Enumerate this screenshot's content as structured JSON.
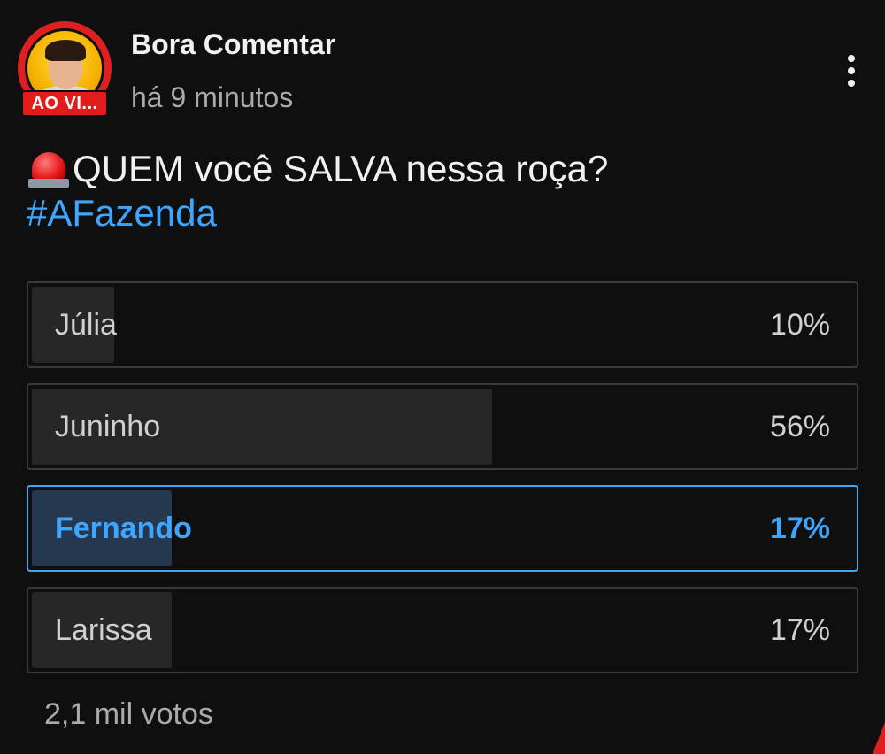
{
  "post": {
    "channel_name": "Bora Comentar",
    "timestamp": "há 9 minutos",
    "live_badge": "AO VI...",
    "avatar_icon": "channel-avatar",
    "menu_icon": "more-vert-icon",
    "question_text": "QUEM você SALVA nessa roça?",
    "question_icon": "police-siren-emoji",
    "hashtag": "#AFazenda"
  },
  "poll": {
    "options": [
      {
        "label": "Júlia",
        "percent_text": "10%",
        "percent": 10,
        "selected": false
      },
      {
        "label": "Juninho",
        "percent_text": "56%",
        "percent": 56,
        "selected": false
      },
      {
        "label": "Fernando",
        "percent_text": "17%",
        "percent": 17,
        "selected": true
      },
      {
        "label": "Larissa",
        "percent_text": "17%",
        "percent": 17,
        "selected": false
      }
    ],
    "votes": "2,1 mil votos"
  },
  "colors": {
    "background": "#0f0f0f",
    "accent_blue": "#3ea6ff",
    "live_red": "#e21b1b",
    "bar_fill": "#272727",
    "selected_fill": "#263850"
  }
}
